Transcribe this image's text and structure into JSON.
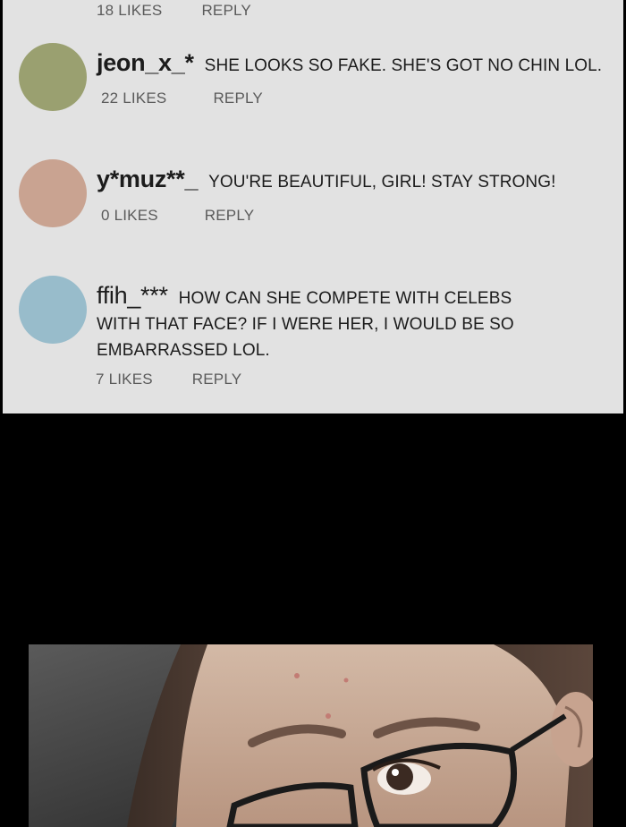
{
  "top_meta": {
    "likes": "18 LIKES",
    "reply": "REPLY"
  },
  "comments": [
    {
      "username": "jeon_x_*",
      "text": "SHE LOOKS SO FAKE. SHE'S GOT NO CHIN LOL.",
      "likes": "22 LIKES",
      "reply": "REPLY",
      "avatar_color": "#9aa070"
    },
    {
      "username": "y*muz**_",
      "text": "YOU'RE BEAUTIFUL, GIRL! STAY STRONG!",
      "likes": "0 LIKES",
      "reply": "REPLY",
      "avatar_color": "#c9a391"
    },
    {
      "username": "ffih_***",
      "text": "HOW CAN SHE COMPETE WITH CELEBS WITH THAT FACE? IF I WERE HER, I WOULD BE SO EMBARRASSED LOL.",
      "likes": "7 LIKES",
      "reply": "REPLY",
      "avatar_color": "#98bccb"
    }
  ],
  "colors": {
    "panel_background": "#e2e2e2",
    "page_background": "#000000",
    "meta_text": "#5a5a5a"
  }
}
